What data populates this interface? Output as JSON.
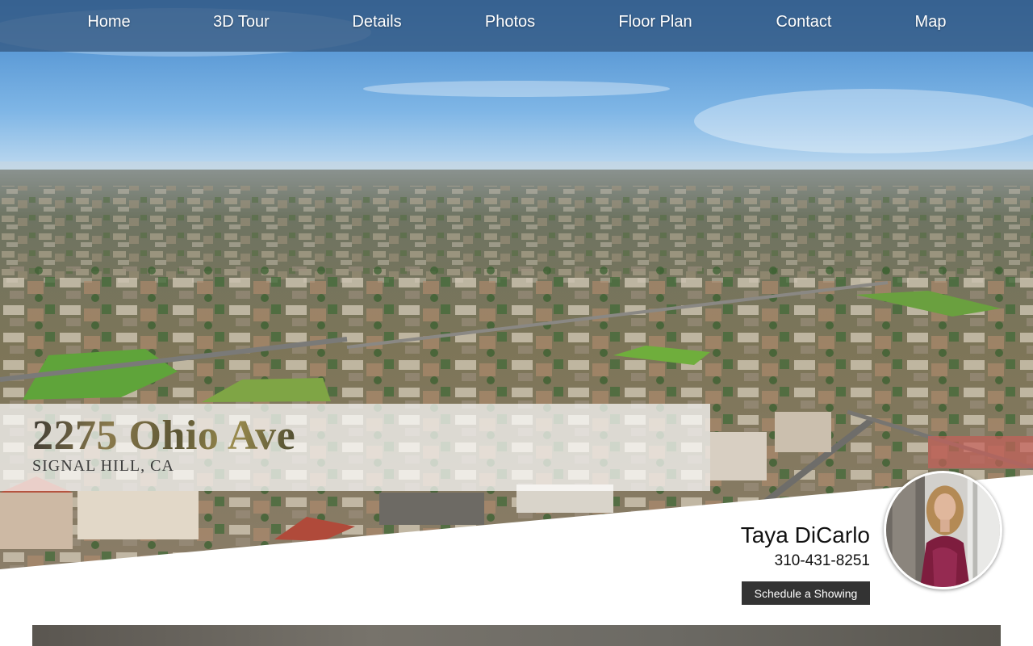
{
  "nav": {
    "items": [
      {
        "label": "Home"
      },
      {
        "label": "3D Tour"
      },
      {
        "label": "Details"
      },
      {
        "label": "Photos"
      },
      {
        "label": "Floor Plan"
      },
      {
        "label": "Contact"
      },
      {
        "label": "Map"
      }
    ]
  },
  "listing": {
    "street": "2275 Ohio Ave",
    "city": "SIGNAL HILL, CA"
  },
  "agent": {
    "name": "Taya DiCarlo",
    "phone": "310-431-8251",
    "cta_label": "Schedule a Showing"
  },
  "colors": {
    "nav_bg": "#345882",
    "button_bg": "#333333"
  }
}
